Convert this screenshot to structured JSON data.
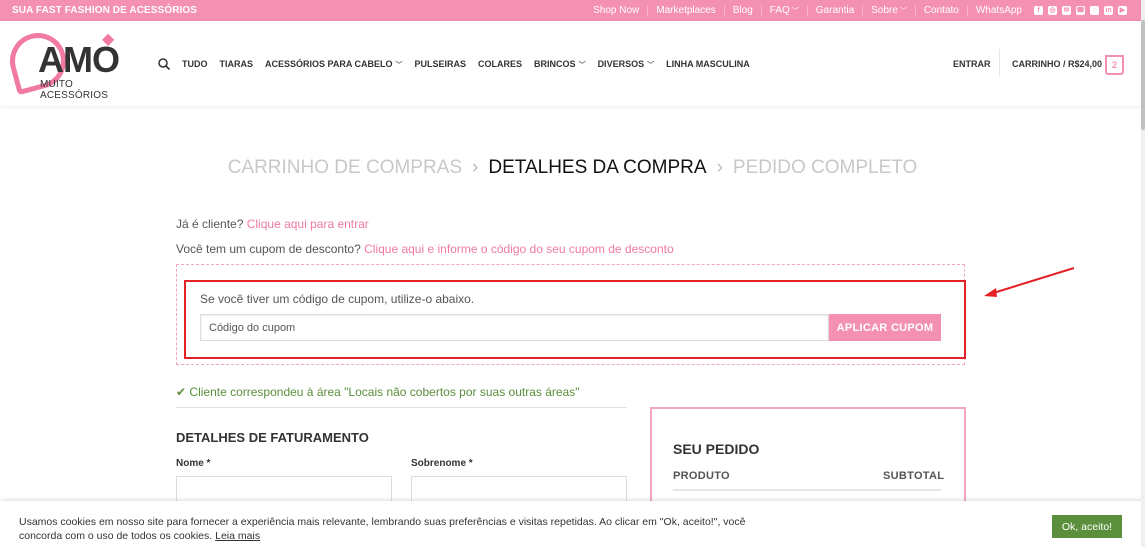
{
  "topbar": {
    "tagline": "SUA FAST FASHION DE ACESSÓRIOS",
    "links": [
      {
        "label": "Shop Now",
        "dropdown": false
      },
      {
        "label": "Marketplaces",
        "dropdown": false
      },
      {
        "label": "Blog",
        "dropdown": false
      },
      {
        "label": "FAQ",
        "dropdown": true
      },
      {
        "label": "Garantia",
        "dropdown": false
      },
      {
        "label": "Sobre",
        "dropdown": true
      },
      {
        "label": "Contato",
        "dropdown": false
      },
      {
        "label": "WhatsApp",
        "dropdown": false
      }
    ],
    "social": [
      "facebook-icon",
      "instagram-icon",
      "email-icon",
      "phone-icon",
      "whatsapp-icon",
      "linkedin-icon",
      "youtube-icon"
    ]
  },
  "logo": {
    "main": "AMO",
    "sub": "MUITO ACESSÓRIOS"
  },
  "nav": {
    "items": [
      {
        "label": "TUDO",
        "dropdown": false
      },
      {
        "label": "TIARAS",
        "dropdown": false
      },
      {
        "label": "ACESSÓRIOS PARA CABELO",
        "dropdown": true
      },
      {
        "label": "PULSEIRAS",
        "dropdown": false
      },
      {
        "label": "COLARES",
        "dropdown": false
      },
      {
        "label": "BRINCOS",
        "dropdown": true
      },
      {
        "label": "DIVERSOS",
        "dropdown": true
      },
      {
        "label": "LINHA MASCULINA",
        "dropdown": false
      }
    ],
    "login": "ENTRAR",
    "cart_label": "CARRINHO / R$24,00",
    "cart_count": "2"
  },
  "steps": {
    "cart": "CARRINHO DE COMPRAS",
    "details": "DETALHES DA COMPRA",
    "complete": "PEDIDO COMPLETO"
  },
  "notices": {
    "returning_text": "Já é cliente? ",
    "returning_link": "Clique aqui para entrar",
    "coupon_text": "Você tem um cupom de desconto? ",
    "coupon_link": "Clique aqui e informe o código do seu cupom de desconto"
  },
  "coupon": {
    "hint": "Se você tiver um código de cupom, utilize-o abaixo.",
    "placeholder": "Código do cupom",
    "apply_label": "APLICAR CUPOM"
  },
  "shipping_match": "Cliente correspondeu à área \"Locais não cobertos por suas outras áreas\"",
  "billing": {
    "title": "DETALHES DE FATURAMENTO",
    "first_name_label": "Nome *",
    "last_name_label": "Sobrenome *"
  },
  "order": {
    "title": "SEU PEDIDO",
    "col_product": "PRODUTO",
    "col_subtotal": "SUBTOTAL"
  },
  "cookie": {
    "text": "Usamos cookies em nosso site para fornecer a experiência mais relevante, lembrando suas preferências e visitas repetidas. Ao clicar em \"Ok, aceito!\", você concorda com o uso de todos os cookies. ",
    "link": "Leia mais",
    "accept": "Ok, aceito!"
  },
  "colors": {
    "brand_pink": "#f491b2",
    "highlight_red": "#e32126",
    "success_green": "#5b8f3c"
  }
}
